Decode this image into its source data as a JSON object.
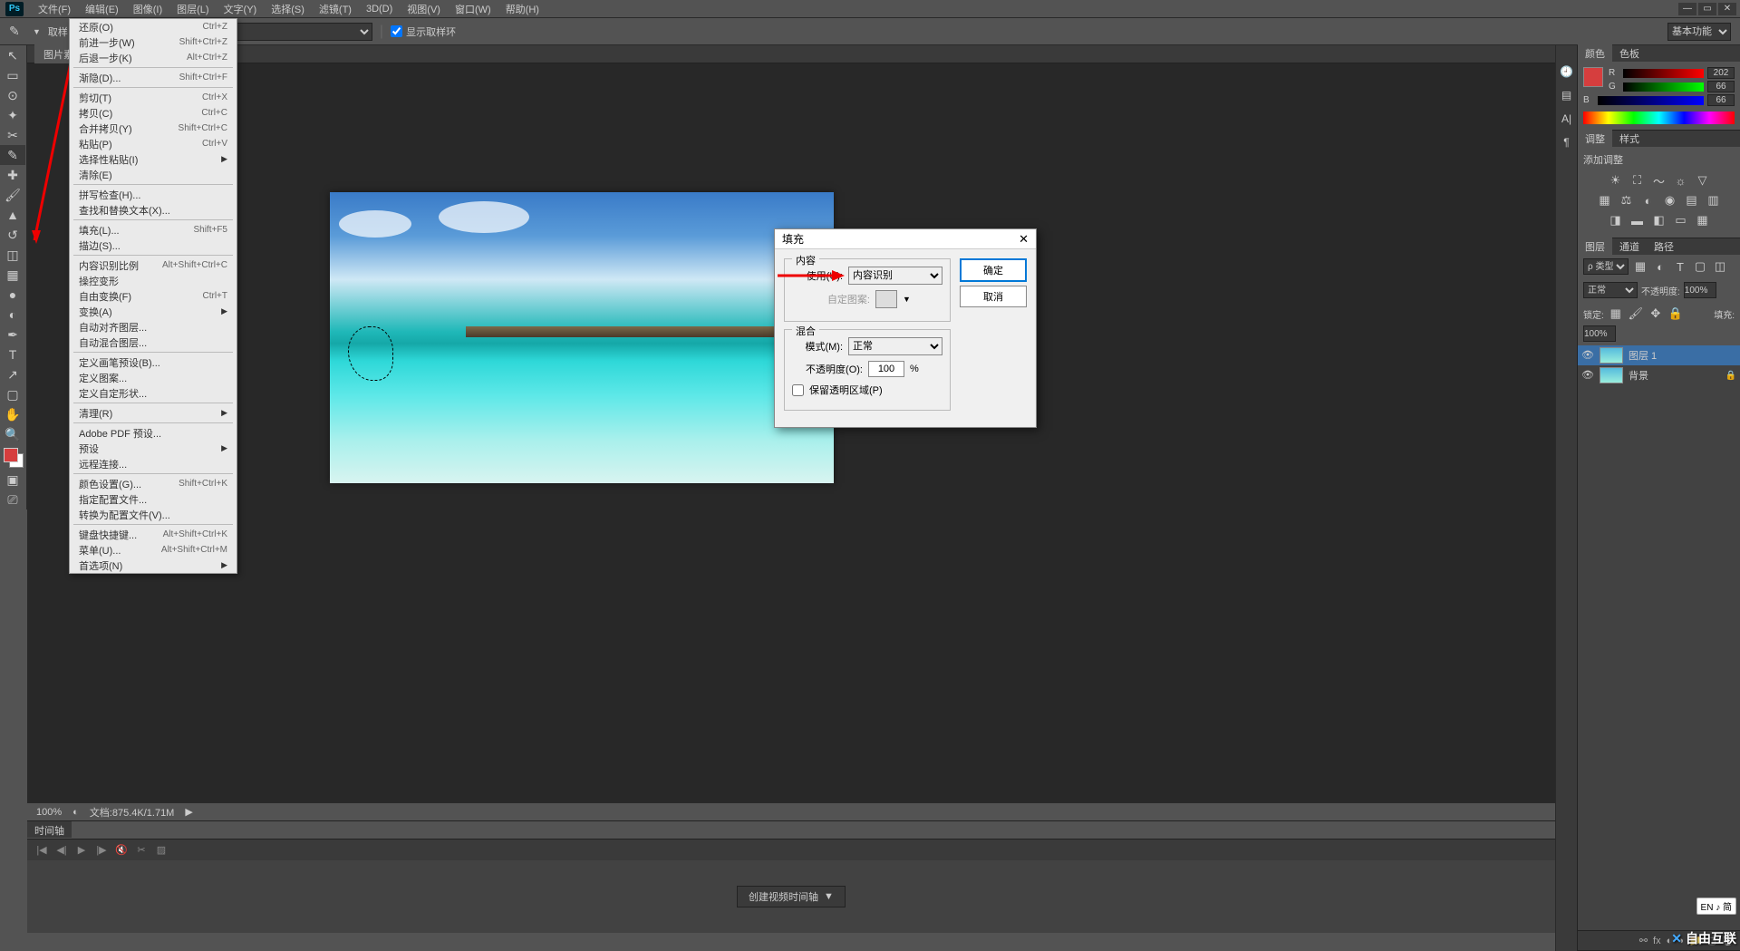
{
  "menuBar": {
    "logo": "Ps",
    "items": [
      "文件(F)",
      "编辑(E)",
      "图像(I)",
      "图层(L)",
      "文字(Y)",
      "选择(S)",
      "滤镜(T)",
      "3D(D)",
      "视图(V)",
      "窗口(W)",
      "帮助(H)"
    ]
  },
  "optionsBar": {
    "sampleLabel": "取样",
    "showSampleRing": "显示取样环",
    "workspace": "基本功能"
  },
  "docTab": "图片素材",
  "editMenu": {
    "items": [
      {
        "label": "还原(O)",
        "shortcut": "Ctrl+Z"
      },
      {
        "label": "前进一步(W)",
        "shortcut": "Shift+Ctrl+Z"
      },
      {
        "label": "后退一步(K)",
        "shortcut": "Alt+Ctrl+Z"
      },
      {
        "sep": true
      },
      {
        "label": "渐隐(D)...",
        "shortcut": "Shift+Ctrl+F"
      },
      {
        "sep": true
      },
      {
        "label": "剪切(T)",
        "shortcut": "Ctrl+X"
      },
      {
        "label": "拷贝(C)",
        "shortcut": "Ctrl+C"
      },
      {
        "label": "合并拷贝(Y)",
        "shortcut": "Shift+Ctrl+C"
      },
      {
        "label": "粘贴(P)",
        "shortcut": "Ctrl+V"
      },
      {
        "label": "选择性粘贴(I)",
        "arrow": true
      },
      {
        "label": "清除(E)"
      },
      {
        "sep": true
      },
      {
        "label": "拼写检查(H)..."
      },
      {
        "label": "查找和替换文本(X)..."
      },
      {
        "sep": true
      },
      {
        "label": "填充(L)...",
        "shortcut": "Shift+F5"
      },
      {
        "label": "描边(S)..."
      },
      {
        "sep": true
      },
      {
        "label": "内容识别比例",
        "shortcut": "Alt+Shift+Ctrl+C"
      },
      {
        "label": "操控变形"
      },
      {
        "label": "自由变换(F)",
        "shortcut": "Ctrl+T"
      },
      {
        "label": "变换(A)",
        "arrow": true
      },
      {
        "label": "自动对齐图层..."
      },
      {
        "label": "自动混合图层..."
      },
      {
        "sep": true
      },
      {
        "label": "定义画笔预设(B)..."
      },
      {
        "label": "定义图案..."
      },
      {
        "label": "定义自定形状..."
      },
      {
        "sep": true
      },
      {
        "label": "清理(R)",
        "arrow": true
      },
      {
        "sep": true
      },
      {
        "label": "Adobe PDF 预设..."
      },
      {
        "label": "预设",
        "arrow": true
      },
      {
        "label": "远程连接..."
      },
      {
        "sep": true
      },
      {
        "label": "颜色设置(G)...",
        "shortcut": "Shift+Ctrl+K"
      },
      {
        "label": "指定配置文件..."
      },
      {
        "label": "转换为配置文件(V)..."
      },
      {
        "sep": true
      },
      {
        "label": "键盘快捷键...",
        "shortcut": "Alt+Shift+Ctrl+K"
      },
      {
        "label": "菜单(U)...",
        "shortcut": "Alt+Shift+Ctrl+M"
      },
      {
        "label": "首选项(N)",
        "arrow": true
      }
    ]
  },
  "fillDialog": {
    "title": "填充",
    "ok": "确定",
    "cancel": "取消",
    "contentLegend": "内容",
    "useLabel": "使用(U):",
    "useValue": "内容识别",
    "patternLabel": "自定图案:",
    "blendLegend": "混合",
    "modeLabel": "模式(M):",
    "modeValue": "正常",
    "opacityLabel": "不透明度(O):",
    "opacityValue": "100",
    "opacityUnit": "%",
    "preserveTransparency": "保留透明区域(P)"
  },
  "statusBar": {
    "zoom": "100%",
    "docInfo": "文档:875.4K/1.71M"
  },
  "timeline": {
    "tab": "时间轴",
    "createBtn": "创建视频时间轴"
  },
  "colorPanel": {
    "tabs": [
      "颜色",
      "色板"
    ],
    "r": {
      "label": "R",
      "value": "202"
    },
    "g": {
      "label": "G",
      "value": "66"
    },
    "b": {
      "label": "B",
      "value": "66"
    }
  },
  "adjustPanel": {
    "tabs": [
      "调整",
      "样式"
    ],
    "title": "添加调整"
  },
  "layersPanel": {
    "tabs": [
      "图层",
      "通道",
      "路径"
    ],
    "kind": "ρ 类型",
    "blendMode": "正常",
    "opacityLabel": "不透明度:",
    "opacityValue": "100%",
    "lockLabel": "锁定:",
    "fillLabel": "填充:",
    "fillValue": "100%",
    "layers": [
      {
        "name": "图层 1",
        "selected": true
      },
      {
        "name": "背景",
        "locked": true
      }
    ]
  },
  "watermark": "自由互联",
  "ime": "EN ♪ 简"
}
